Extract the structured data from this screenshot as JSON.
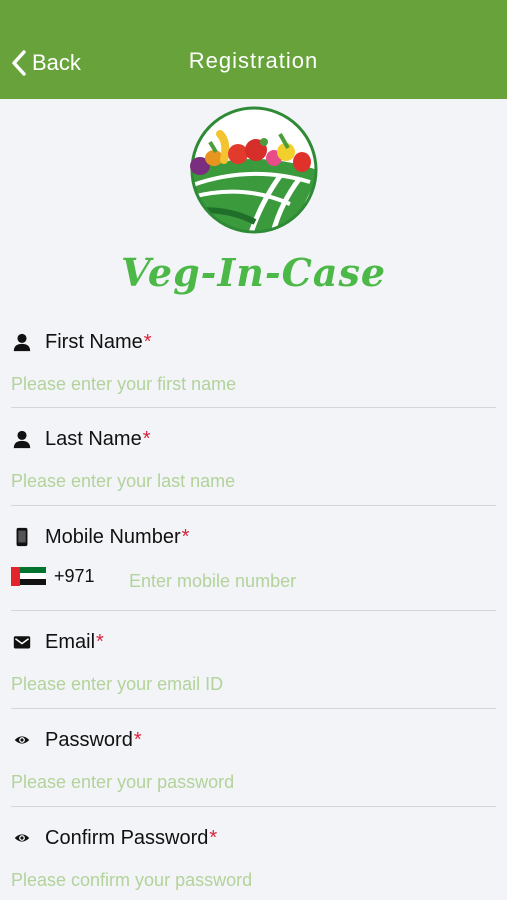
{
  "nav": {
    "back_label": "Back",
    "title": "Registration",
    "bg_color": "#67a33a"
  },
  "brand": {
    "name": "Veg-In-Case",
    "color": "#4cb848"
  },
  "fields": {
    "first_name": {
      "label": "First Name",
      "required": "*",
      "placeholder": "Please enter your first name",
      "icon": "person-icon"
    },
    "last_name": {
      "label": "Last Name",
      "required": "*",
      "placeholder": "Please enter your last name",
      "icon": "person-icon"
    },
    "mobile": {
      "label": "Mobile Number",
      "required": "*",
      "country_code": "+971",
      "placeholder": "Enter mobile number",
      "icon": "phone-icon",
      "flag": "uae-flag"
    },
    "email": {
      "label": "Email",
      "required": "*",
      "placeholder": "Please enter your email ID",
      "icon": "mail-icon"
    },
    "password": {
      "label": "Password",
      "required": "*",
      "placeholder": "Please enter your password",
      "icon": "eye-icon"
    },
    "confirm_password": {
      "label": "Confirm Password",
      "required": "*",
      "placeholder": "Please confirm your password",
      "icon": "eye-icon"
    }
  },
  "colors": {
    "placeholder": "#b3d39a",
    "required": "#d9233a"
  }
}
